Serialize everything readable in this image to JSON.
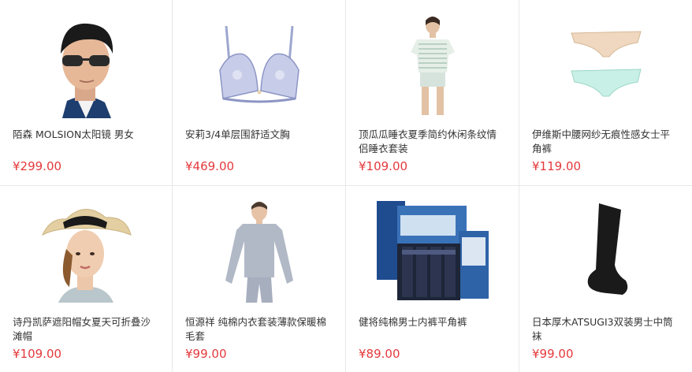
{
  "products": [
    {
      "title": "陌森 MOLSION太阳镜 男女",
      "price": "¥299.00",
      "image": "man-sunglasses-photo"
    },
    {
      "title": "安莉3/4单层围舒适文胸",
      "price": "¥469.00",
      "image": "lace-bra-photo"
    },
    {
      "title": "顶瓜瓜睡衣夏季简约休闲条纹情侣睡衣套装",
      "price": "¥109.00",
      "image": "striped-pajamas-photo"
    },
    {
      "title": "伊维斯中腰网纱无痕性感女士平角裤",
      "price": "¥119.00",
      "image": "panties-photo"
    },
    {
      "title": "诗丹凯萨遮阳帽女夏天可折叠沙滩帽",
      "price": "¥109.00",
      "image": "sun-hat-woman-photo"
    },
    {
      "title": "恒源祥 纯棉内衣套装薄款保暖棉毛套",
      "price": "¥99.00",
      "image": "thermal-underwear-photo"
    },
    {
      "title": "健将纯棉男士内裤平角裤",
      "price": "¥89.00",
      "image": "boxer-briefs-box-photo"
    },
    {
      "title": "日本厚木ATSUGI3双装男士中筒袜",
      "price": "¥99.00",
      "image": "black-socks-photo"
    }
  ],
  "colors": {
    "price": "#e4393c",
    "divider": "#e8e8e8",
    "title": "#333333"
  }
}
